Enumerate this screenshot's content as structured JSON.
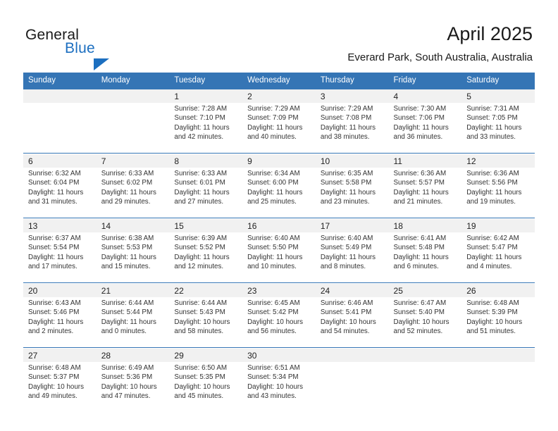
{
  "brand": {
    "name_part1": "General",
    "name_part2": "Blue",
    "triangle_color": "#1c6fc0"
  },
  "header": {
    "title": "April 2025",
    "subtitle": "Everard Park, South Australia, Australia"
  },
  "colors": {
    "header_blue": "#3575b5",
    "daynum_band": "#f1f1f1",
    "text": "#222222"
  },
  "weekday_headers": [
    "Sunday",
    "Monday",
    "Tuesday",
    "Wednesday",
    "Thursday",
    "Friday",
    "Saturday"
  ],
  "weeks": [
    {
      "days": [
        {
          "num": "",
          "sunrise": "",
          "sunset": "",
          "daylight_line1": "",
          "daylight_line2": ""
        },
        {
          "num": "",
          "sunrise": "",
          "sunset": "",
          "daylight_line1": "",
          "daylight_line2": ""
        },
        {
          "num": "1",
          "sunrise": "Sunrise: 7:28 AM",
          "sunset": "Sunset: 7:10 PM",
          "daylight_line1": "Daylight: 11 hours",
          "daylight_line2": "and 42 minutes."
        },
        {
          "num": "2",
          "sunrise": "Sunrise: 7:29 AM",
          "sunset": "Sunset: 7:09 PM",
          "daylight_line1": "Daylight: 11 hours",
          "daylight_line2": "and 40 minutes."
        },
        {
          "num": "3",
          "sunrise": "Sunrise: 7:29 AM",
          "sunset": "Sunset: 7:08 PM",
          "daylight_line1": "Daylight: 11 hours",
          "daylight_line2": "and 38 minutes."
        },
        {
          "num": "4",
          "sunrise": "Sunrise: 7:30 AM",
          "sunset": "Sunset: 7:06 PM",
          "daylight_line1": "Daylight: 11 hours",
          "daylight_line2": "and 36 minutes."
        },
        {
          "num": "5",
          "sunrise": "Sunrise: 7:31 AM",
          "sunset": "Sunset: 7:05 PM",
          "daylight_line1": "Daylight: 11 hours",
          "daylight_line2": "and 33 minutes."
        }
      ]
    },
    {
      "days": [
        {
          "num": "6",
          "sunrise": "Sunrise: 6:32 AM",
          "sunset": "Sunset: 6:04 PM",
          "daylight_line1": "Daylight: 11 hours",
          "daylight_line2": "and 31 minutes."
        },
        {
          "num": "7",
          "sunrise": "Sunrise: 6:33 AM",
          "sunset": "Sunset: 6:02 PM",
          "daylight_line1": "Daylight: 11 hours",
          "daylight_line2": "and 29 minutes."
        },
        {
          "num": "8",
          "sunrise": "Sunrise: 6:33 AM",
          "sunset": "Sunset: 6:01 PM",
          "daylight_line1": "Daylight: 11 hours",
          "daylight_line2": "and 27 minutes."
        },
        {
          "num": "9",
          "sunrise": "Sunrise: 6:34 AM",
          "sunset": "Sunset: 6:00 PM",
          "daylight_line1": "Daylight: 11 hours",
          "daylight_line2": "and 25 minutes."
        },
        {
          "num": "10",
          "sunrise": "Sunrise: 6:35 AM",
          "sunset": "Sunset: 5:58 PM",
          "daylight_line1": "Daylight: 11 hours",
          "daylight_line2": "and 23 minutes."
        },
        {
          "num": "11",
          "sunrise": "Sunrise: 6:36 AM",
          "sunset": "Sunset: 5:57 PM",
          "daylight_line1": "Daylight: 11 hours",
          "daylight_line2": "and 21 minutes."
        },
        {
          "num": "12",
          "sunrise": "Sunrise: 6:36 AM",
          "sunset": "Sunset: 5:56 PM",
          "daylight_line1": "Daylight: 11 hours",
          "daylight_line2": "and 19 minutes."
        }
      ]
    },
    {
      "days": [
        {
          "num": "13",
          "sunrise": "Sunrise: 6:37 AM",
          "sunset": "Sunset: 5:54 PM",
          "daylight_line1": "Daylight: 11 hours",
          "daylight_line2": "and 17 minutes."
        },
        {
          "num": "14",
          "sunrise": "Sunrise: 6:38 AM",
          "sunset": "Sunset: 5:53 PM",
          "daylight_line1": "Daylight: 11 hours",
          "daylight_line2": "and 15 minutes."
        },
        {
          "num": "15",
          "sunrise": "Sunrise: 6:39 AM",
          "sunset": "Sunset: 5:52 PM",
          "daylight_line1": "Daylight: 11 hours",
          "daylight_line2": "and 12 minutes."
        },
        {
          "num": "16",
          "sunrise": "Sunrise: 6:40 AM",
          "sunset": "Sunset: 5:50 PM",
          "daylight_line1": "Daylight: 11 hours",
          "daylight_line2": "and 10 minutes."
        },
        {
          "num": "17",
          "sunrise": "Sunrise: 6:40 AM",
          "sunset": "Sunset: 5:49 PM",
          "daylight_line1": "Daylight: 11 hours",
          "daylight_line2": "and 8 minutes."
        },
        {
          "num": "18",
          "sunrise": "Sunrise: 6:41 AM",
          "sunset": "Sunset: 5:48 PM",
          "daylight_line1": "Daylight: 11 hours",
          "daylight_line2": "and 6 minutes."
        },
        {
          "num": "19",
          "sunrise": "Sunrise: 6:42 AM",
          "sunset": "Sunset: 5:47 PM",
          "daylight_line1": "Daylight: 11 hours",
          "daylight_line2": "and 4 minutes."
        }
      ]
    },
    {
      "days": [
        {
          "num": "20",
          "sunrise": "Sunrise: 6:43 AM",
          "sunset": "Sunset: 5:46 PM",
          "daylight_line1": "Daylight: 11 hours",
          "daylight_line2": "and 2 minutes."
        },
        {
          "num": "21",
          "sunrise": "Sunrise: 6:44 AM",
          "sunset": "Sunset: 5:44 PM",
          "daylight_line1": "Daylight: 11 hours",
          "daylight_line2": "and 0 minutes."
        },
        {
          "num": "22",
          "sunrise": "Sunrise: 6:44 AM",
          "sunset": "Sunset: 5:43 PM",
          "daylight_line1": "Daylight: 10 hours",
          "daylight_line2": "and 58 minutes."
        },
        {
          "num": "23",
          "sunrise": "Sunrise: 6:45 AM",
          "sunset": "Sunset: 5:42 PM",
          "daylight_line1": "Daylight: 10 hours",
          "daylight_line2": "and 56 minutes."
        },
        {
          "num": "24",
          "sunrise": "Sunrise: 6:46 AM",
          "sunset": "Sunset: 5:41 PM",
          "daylight_line1": "Daylight: 10 hours",
          "daylight_line2": "and 54 minutes."
        },
        {
          "num": "25",
          "sunrise": "Sunrise: 6:47 AM",
          "sunset": "Sunset: 5:40 PM",
          "daylight_line1": "Daylight: 10 hours",
          "daylight_line2": "and 52 minutes."
        },
        {
          "num": "26",
          "sunrise": "Sunrise: 6:48 AM",
          "sunset": "Sunset: 5:39 PM",
          "daylight_line1": "Daylight: 10 hours",
          "daylight_line2": "and 51 minutes."
        }
      ]
    },
    {
      "days": [
        {
          "num": "27",
          "sunrise": "Sunrise: 6:48 AM",
          "sunset": "Sunset: 5:37 PM",
          "daylight_line1": "Daylight: 10 hours",
          "daylight_line2": "and 49 minutes."
        },
        {
          "num": "28",
          "sunrise": "Sunrise: 6:49 AM",
          "sunset": "Sunset: 5:36 PM",
          "daylight_line1": "Daylight: 10 hours",
          "daylight_line2": "and 47 minutes."
        },
        {
          "num": "29",
          "sunrise": "Sunrise: 6:50 AM",
          "sunset": "Sunset: 5:35 PM",
          "daylight_line1": "Daylight: 10 hours",
          "daylight_line2": "and 45 minutes."
        },
        {
          "num": "30",
          "sunrise": "Sunrise: 6:51 AM",
          "sunset": "Sunset: 5:34 PM",
          "daylight_line1": "Daylight: 10 hours",
          "daylight_line2": "and 43 minutes."
        },
        {
          "num": "",
          "sunrise": "",
          "sunset": "",
          "daylight_line1": "",
          "daylight_line2": ""
        },
        {
          "num": "",
          "sunrise": "",
          "sunset": "",
          "daylight_line1": "",
          "daylight_line2": ""
        },
        {
          "num": "",
          "sunrise": "",
          "sunset": "",
          "daylight_line1": "",
          "daylight_line2": ""
        }
      ]
    }
  ]
}
